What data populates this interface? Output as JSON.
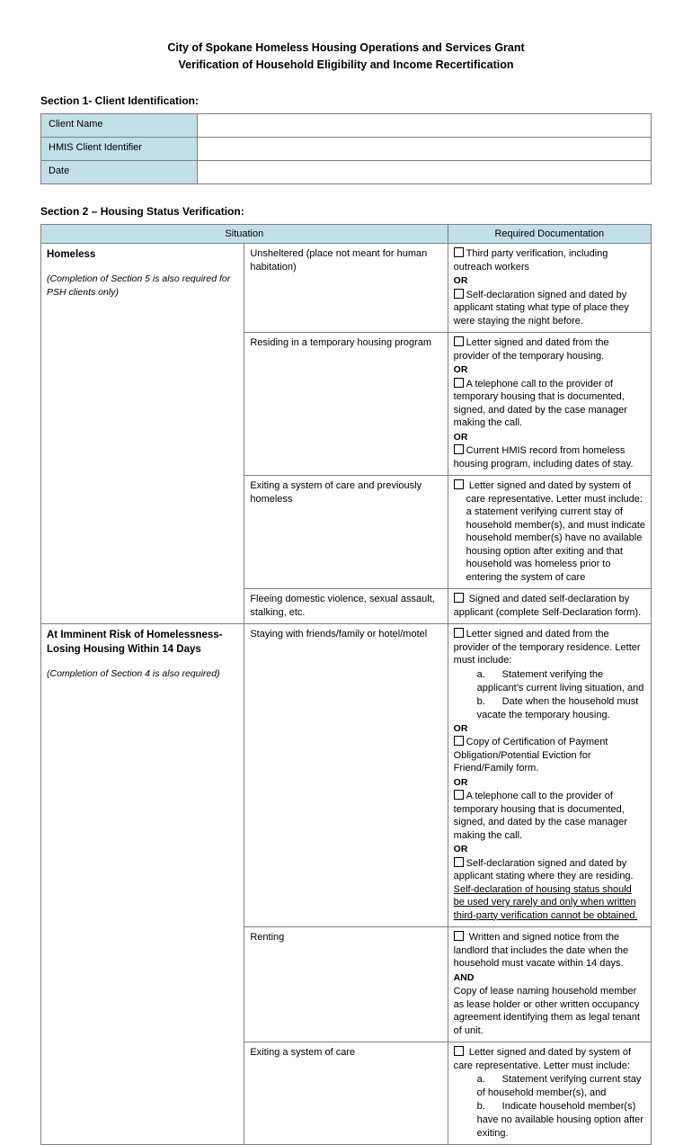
{
  "document": {
    "title_line1": "City of Spokane Homeless Housing Operations and Services Grant",
    "title_line2": "Verification of Household Eligibility and Income Recertification",
    "section1_heading": "Section 1- Client Identification:",
    "section2_heading": "Section 2 – Housing Status Verification:"
  },
  "section1": {
    "rows": [
      {
        "label": "Client Name",
        "value": ""
      },
      {
        "label": "HMIS Client Identifier",
        "value": ""
      },
      {
        "label": "Date",
        "value": ""
      }
    ]
  },
  "section2": {
    "headers": {
      "situation": "Situation",
      "documentation": "Required Documentation"
    },
    "categories": [
      {
        "title": "Homeless",
        "note": "(Completion of Section 5 is also required for PSH clients only)",
        "rows": [
          {
            "situation": "Unsheltered (place not meant for human habitation)",
            "items": [
              {
                "type": "checkbox",
                "text": "Third party verification, including outreach workers"
              },
              {
                "type": "or",
                "text": "OR"
              },
              {
                "type": "checkbox",
                "text": "Self-declaration signed and dated by applicant stating what type of place they were staying the night before."
              }
            ]
          },
          {
            "situation": "Residing in a temporary housing program",
            "items": [
              {
                "type": "checkbox",
                "text": "Letter signed and dated from the provider of the temporary housing."
              },
              {
                "type": "or",
                "text": "OR"
              },
              {
                "type": "checkbox",
                "text": "A telephone call to the provider of temporary housing that is documented, signed, and dated by the case manager making the call."
              },
              {
                "type": "or",
                "text": "OR"
              },
              {
                "type": "checkbox",
                "text": "Current HMIS record from homeless housing program, including dates of stay."
              }
            ]
          },
          {
            "situation": "Exiting a system of care and previously homeless",
            "items": [
              {
                "type": "checkbox",
                "text": "Letter signed and dated by system of care representative.  Letter must include: a statement verifying current stay of household member(s), and must indicate household member(s) have no available housing option after exiting and that household was homeless prior to entering the system of care"
              }
            ]
          },
          {
            "situation": "Fleeing domestic violence, sexual assault, stalking, etc.",
            "items": [
              {
                "type": "checkbox",
                "text": "Signed and dated self-declaration by applicant (complete Self-Declaration form)."
              }
            ]
          }
        ]
      },
      {
        "title": "At Imminent Risk of Homelessness- Losing Housing Within 14 Days",
        "note": "(Completion of Section 4 is also required)",
        "rows": [
          {
            "situation": "Staying with friends/family or hotel/motel",
            "items": [
              {
                "type": "checkbox",
                "text": "Letter signed and dated from the provider of the temporary residence. Letter must include:"
              },
              {
                "type": "sublist",
                "entries": [
                  {
                    "mark": "a.",
                    "text": "Statement verifying the applicant’s current living situation, and"
                  },
                  {
                    "mark": "b.",
                    "text": "Date when the household must vacate the temporary housing."
                  }
                ]
              },
              {
                "type": "or",
                "text": "OR"
              },
              {
                "type": "checkbox",
                "text": "Copy of Certification of Payment Obligation/Potential Eviction for Friend/Family form."
              },
              {
                "type": "or",
                "text": "OR"
              },
              {
                "type": "checkbox",
                "text": "A telephone call to the provider of temporary housing that is documented, signed, and dated by the case manager making the call."
              },
              {
                "type": "or",
                "text": "OR"
              },
              {
                "type": "checkbox_mixed",
                "text": "Self-declaration signed and dated by applicant stating where they are residing.  ",
                "underline": "Self-declaration of housing status should be used very rarely and only when written third-party verification cannot be obtained."
              }
            ]
          },
          {
            "situation": "Renting",
            "items": [
              {
                "type": "checkbox",
                "text": "Written and signed notice from the landlord that includes the date when the household must vacate within 14 days."
              },
              {
                "type": "or",
                "text": "AND"
              },
              {
                "type": "plain",
                "text": "Copy of lease naming household member as lease holder or other written occupancy agreement identifying them as legal tenant of unit."
              }
            ]
          },
          {
            "situation": "Exiting a system of care",
            "items": [
              {
                "type": "checkbox",
                "text": "Letter signed and dated by system of care representative.  Letter must include:"
              },
              {
                "type": "sublist",
                "entries": [
                  {
                    "mark": "a.",
                    "text": "Statement verifying current stay of household member(s), and"
                  },
                  {
                    "mark": "b.",
                    "text": "Indicate household member(s) have no available housing option after exiting."
                  }
                ]
              }
            ]
          }
        ]
      }
    ]
  },
  "colors": {
    "header_fill": "#c3dfe9",
    "border": "#808080"
  }
}
